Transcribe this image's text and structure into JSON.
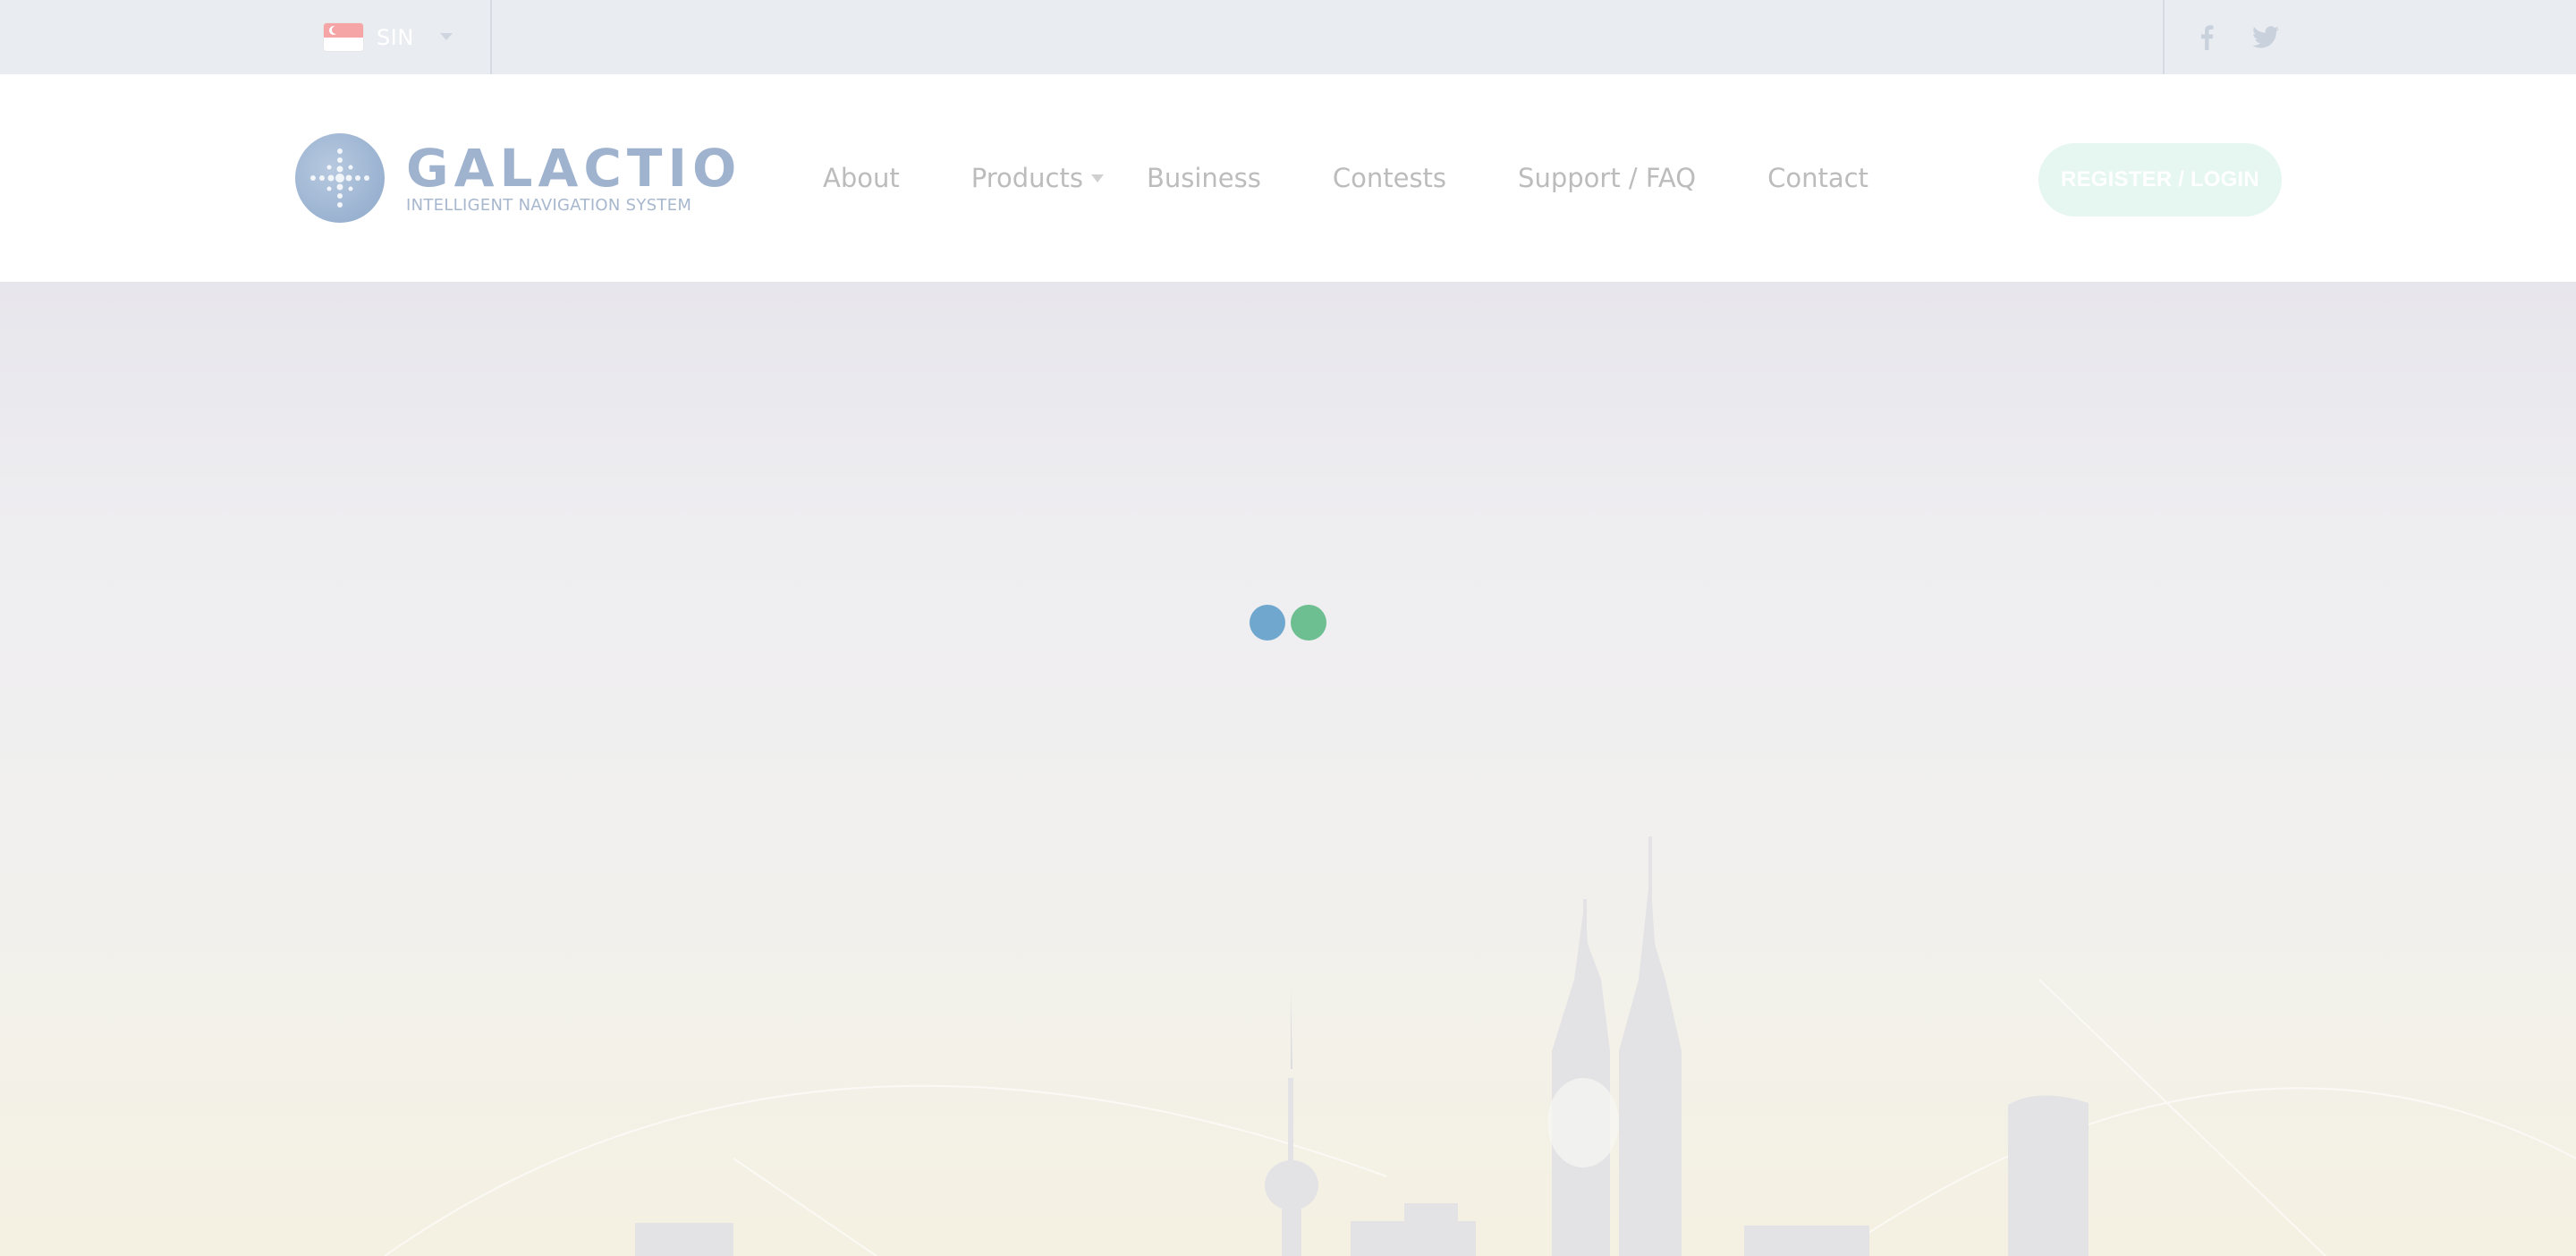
{
  "topbar": {
    "locale": {
      "label": "SIN",
      "flag": "singapore-flag-icon"
    },
    "socials": [
      {
        "name": "facebook-icon",
        "color": "#c9d1dc"
      },
      {
        "name": "twitter-icon",
        "color": "#c9d1dc"
      }
    ]
  },
  "header": {
    "logo": {
      "title": "GALACTIO",
      "subtitle": "INTELLIGENT NAVIGATION SYSTEM"
    },
    "nav": [
      {
        "label": "About"
      },
      {
        "label": "Products",
        "has_dropdown": true
      },
      {
        "label": "Business"
      },
      {
        "label": "Contests"
      },
      {
        "label": "Support / FAQ"
      },
      {
        "label": "Contact"
      }
    ],
    "register_label": "REGISTER / LOGIN"
  },
  "hero": {
    "loading": true,
    "loader_colors": [
      "#6fa7cf",
      "#6dbf92"
    ],
    "background": "city-skyline-image"
  }
}
